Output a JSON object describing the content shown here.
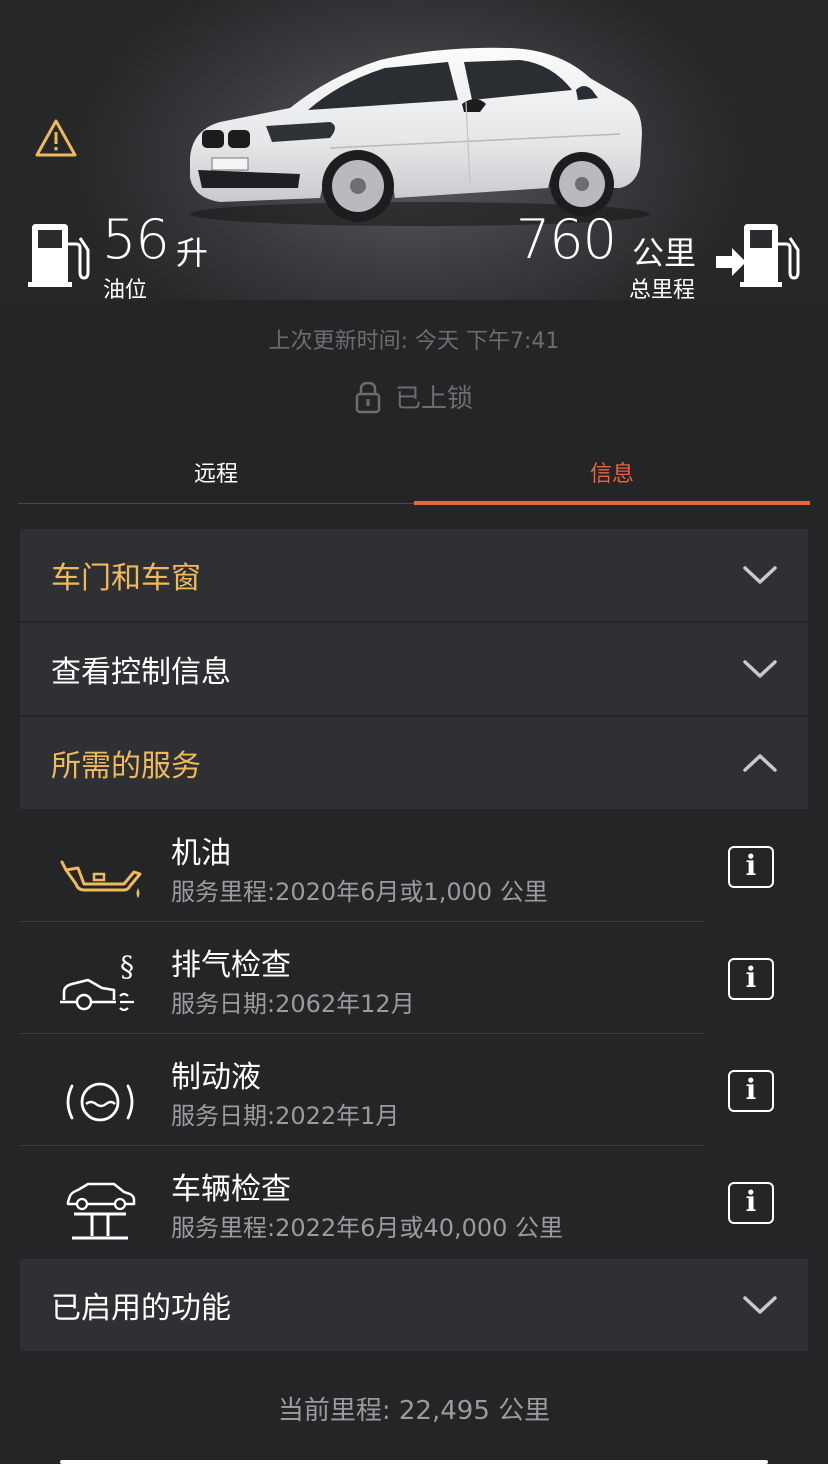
{
  "status": {
    "fuel_value": "56",
    "fuel_unit": "升",
    "fuel_label": "油位",
    "range_value": "760",
    "range_unit": "公里",
    "range_label": "总里程",
    "last_updated": "上次更新时间:  今天 下午7:41",
    "lock_status": "已上锁"
  },
  "tabs": [
    {
      "label": "远程",
      "active": false
    },
    {
      "label": "信息",
      "active": true
    }
  ],
  "sections": {
    "doors": {
      "title": "车门和车窗",
      "expanded": false
    },
    "control": {
      "title": "查看控制信息",
      "expanded": false
    },
    "services": {
      "title": "所需的服务",
      "expanded": true
    },
    "features": {
      "title": "已启用的功能",
      "expanded": false
    }
  },
  "service_items": [
    {
      "title": "机油",
      "detail": "服务里程:2020年6月或1,000 公里",
      "icon": "oil-can-icon"
    },
    {
      "title": "排气检查",
      "detail": "服务日期:2062年12月",
      "icon": "exhaust-check-icon"
    },
    {
      "title": "制动液",
      "detail": "服务日期:2022年1月",
      "icon": "brake-fluid-icon"
    },
    {
      "title": "车辆检查",
      "detail": "服务里程:2022年6月或40,000 公里",
      "icon": "vehicle-lift-icon"
    }
  ],
  "current_mileage": "当前里程:  22,495 公里",
  "colors": {
    "accent": "#e8643c",
    "gold": "#f0b95a",
    "background": "#242527",
    "panel": "#2f3033"
  }
}
